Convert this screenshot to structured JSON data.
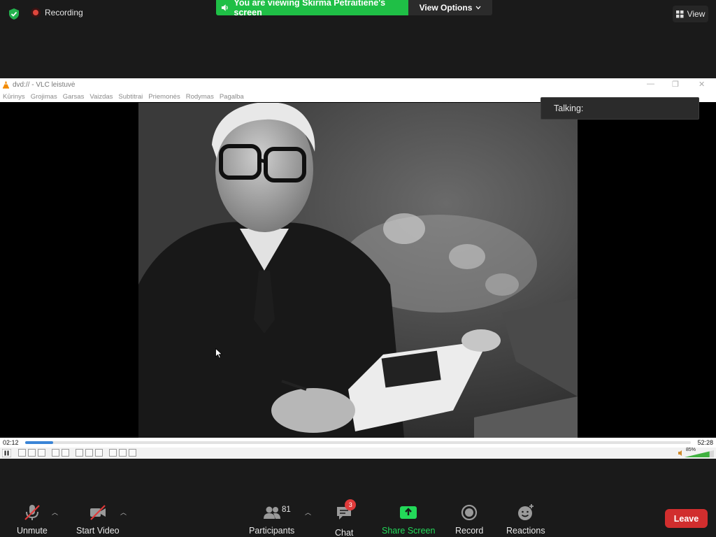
{
  "topbar": {
    "recording_label": "Recording",
    "viewing_banner": "You are viewing Skirma Petraitienė's screen",
    "view_options_label": "View Options",
    "view_button_label": "View"
  },
  "vlc": {
    "title": "dvd:// - VLC leistuvė",
    "menu": [
      "Kūrinys",
      "Grojimas",
      "Garsas",
      "Vaizdas",
      "Subtitrai",
      "Priemonės",
      "Rodymas",
      "Pagalba"
    ],
    "time_elapsed": "02:12",
    "time_total": "52:28",
    "progress": 0.042,
    "volume_label": "85%",
    "volume": 0.85
  },
  "talking": {
    "label": "Talking:"
  },
  "toolbar": {
    "unmute": "Unmute",
    "start_video": "Start Video",
    "participants": "Participants",
    "participants_count": "81",
    "chat": "Chat",
    "chat_badge": "3",
    "share_screen": "Share Screen",
    "record": "Record",
    "reactions": "Reactions",
    "leave": "Leave"
  },
  "colors": {
    "banner_green": "#1fbf46",
    "leave_red": "#d12e2e",
    "share_green": "#23d959",
    "seek_blue": "#3a84d6"
  }
}
